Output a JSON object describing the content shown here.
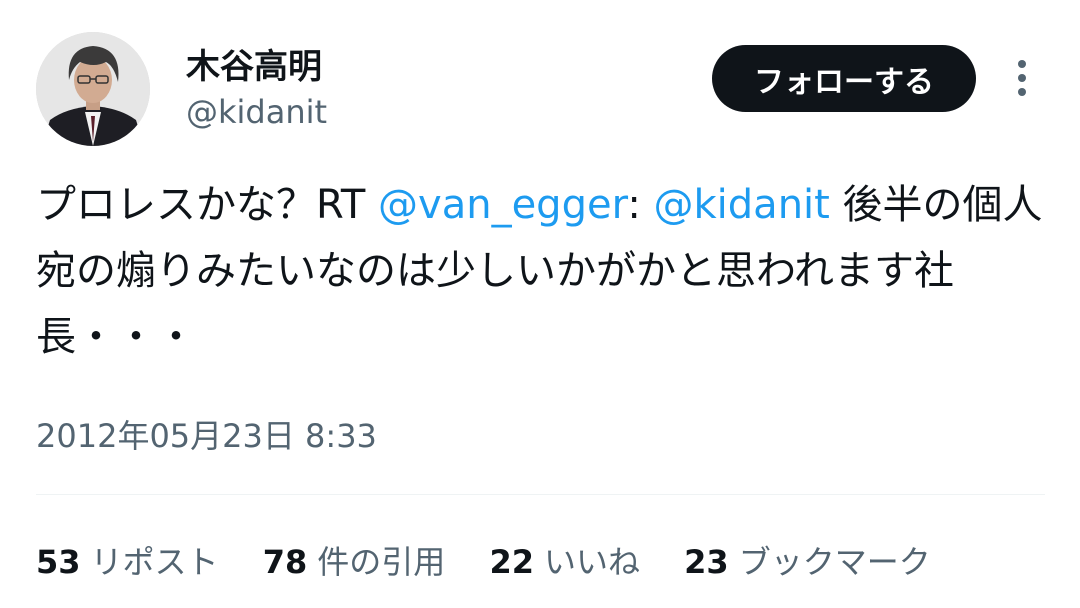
{
  "author": {
    "display_name": "木谷高明",
    "handle": "@kidanit"
  },
  "header": {
    "follow_label": "フォローする",
    "more_icon": "vertical-ellipsis"
  },
  "tweet": {
    "text_part1": "プロレスかな？RT ",
    "mention1": "@van_egger",
    "text_part2": ": ",
    "mention2": "@kidanit",
    "text_part3": " 後半の個人宛の煽りみたいなのは少しいかがかと思われます社長・・・",
    "mention_color": "#1d9bf0"
  },
  "timestamp": "2012年05月23日 8:33",
  "stats": [
    {
      "count": "53",
      "label": "リポスト"
    },
    {
      "count": "78",
      "label": "件の引用"
    },
    {
      "count": "22",
      "label": "いいね"
    },
    {
      "count": "23",
      "label": "ブックマーク"
    }
  ]
}
